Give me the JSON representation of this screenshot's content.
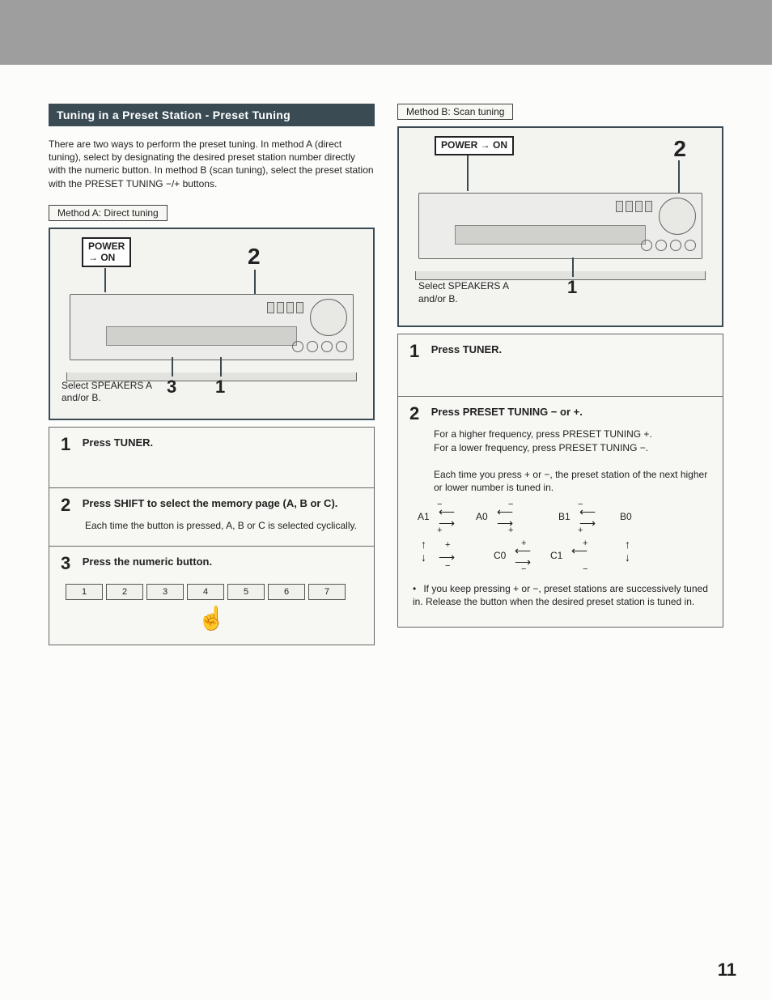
{
  "header": {
    "title": "Tuning in a Preset Station - Preset Tuning"
  },
  "intro": "There are two ways to perform the preset tuning. In method A (direct tuning), select by designating the desired preset station number directly with the numeric button. In method B (scan tuning), select the preset station with the PRESET TUNING −/+ buttons.",
  "methodA": {
    "label": "Method A: Direct tuning",
    "power_label_line1": "POWER",
    "power_label_line2": "→ ON",
    "callout_2": "2",
    "callout_3": "3",
    "callout_1": "1",
    "speakers_line1": "Select SPEAKERS A",
    "speakers_line2": "and/or B.",
    "steps": [
      {
        "num": "1",
        "title": "Press TUNER.",
        "body": ""
      },
      {
        "num": "2",
        "title": "Press SHIFT to select the memory page (A, B or C).",
        "body": "Each time the button is pressed, A, B or C is selected cyclically."
      },
      {
        "num": "3",
        "title": "Press the numeric button.",
        "body": ""
      }
    ],
    "numbuttons": [
      "1",
      "2",
      "3",
      "4",
      "5",
      "6",
      "7"
    ]
  },
  "methodB": {
    "label": "Method B: Scan tuning",
    "power_label": "POWER → ON",
    "callout_2": "2",
    "callout_1": "1",
    "speakers_line1": "Select SPEAKERS A",
    "speakers_line2": "and/or B.",
    "steps": [
      {
        "num": "1",
        "title": "Press TUNER.",
        "body": ""
      },
      {
        "num": "2",
        "title": "Press PRESET TUNING − or +.",
        "body1": "For a higher frequency, press PRESET TUNING +.",
        "body2": "For a lower frequency, press PRESET TUNING −.",
        "body3": "Each time you press + or −, the preset station of the next higher or lower number is tuned in."
      }
    ],
    "cycle": {
      "A1": "A1",
      "A0": "A0",
      "B1": "B1",
      "B0": "B0",
      "C0": "C0",
      "C1": "C1",
      "minus": "−",
      "plus": "+"
    },
    "note": "If you keep pressing + or −, preset stations are successively tuned in. Release the button when the desired preset station is tuned in."
  },
  "page_number": "11"
}
